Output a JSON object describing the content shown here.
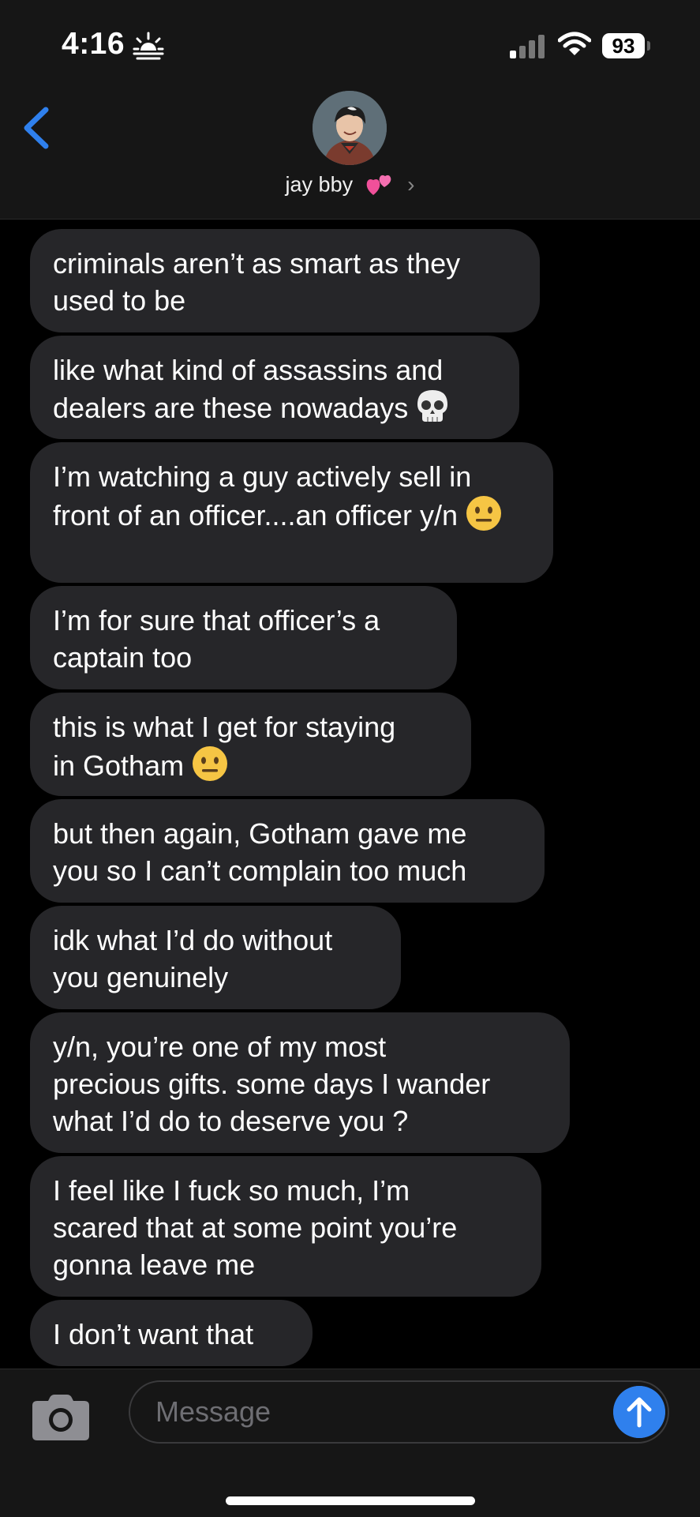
{
  "status_bar": {
    "time": "4:16",
    "battery": "93",
    "icons": [
      "sunrise-icon",
      "signal-icon",
      "wifi-icon",
      "battery-icon"
    ]
  },
  "header": {
    "contact_name": "jay bby",
    "icons": [
      "back-chevron-icon",
      "avatar",
      "two-hearts-emoji",
      "chevron-right-icon"
    ]
  },
  "messages": [
    {
      "text": "criminals aren’t as smart as they\nused to be",
      "emoji": ""
    },
    {
      "text": "like what kind of assassins and\ndealers are these nowadays",
      "emoji": "skull"
    },
    {
      "text": "I’m watching a guy actively sell in\nfront of an officer....an officer y/n",
      "emoji": "neutral-face"
    },
    {
      "text": "I’m for sure that officer’s a\ncaptain too",
      "emoji": ""
    },
    {
      "text": "this is what I get for staying\nin Gotham",
      "emoji": "neutral-face"
    },
    {
      "text": "but then again, Gotham gave me\nyou so I can’t complain too much",
      "emoji": ""
    },
    {
      "text": "idk what I’d do without\nyou genuinely",
      "emoji": ""
    },
    {
      "text": "y/n, you’re one of my most\nprecious gifts. some days I wander\nwhat I’d do to deserve you ?",
      "emoji": ""
    },
    {
      "text": "I feel like I fuck so much, I’m\nscared that at some point you’re\ngonna leave me",
      "emoji": ""
    },
    {
      "text": "I don’t want that",
      "emoji": ""
    }
  ],
  "composer": {
    "placeholder": "Message",
    "icons": [
      "camera-icon",
      "send-arrow-icon"
    ]
  },
  "colors": {
    "bubble_received": "#262629",
    "send_button": "#2f80ed",
    "back_chevron": "#2f80ed"
  }
}
